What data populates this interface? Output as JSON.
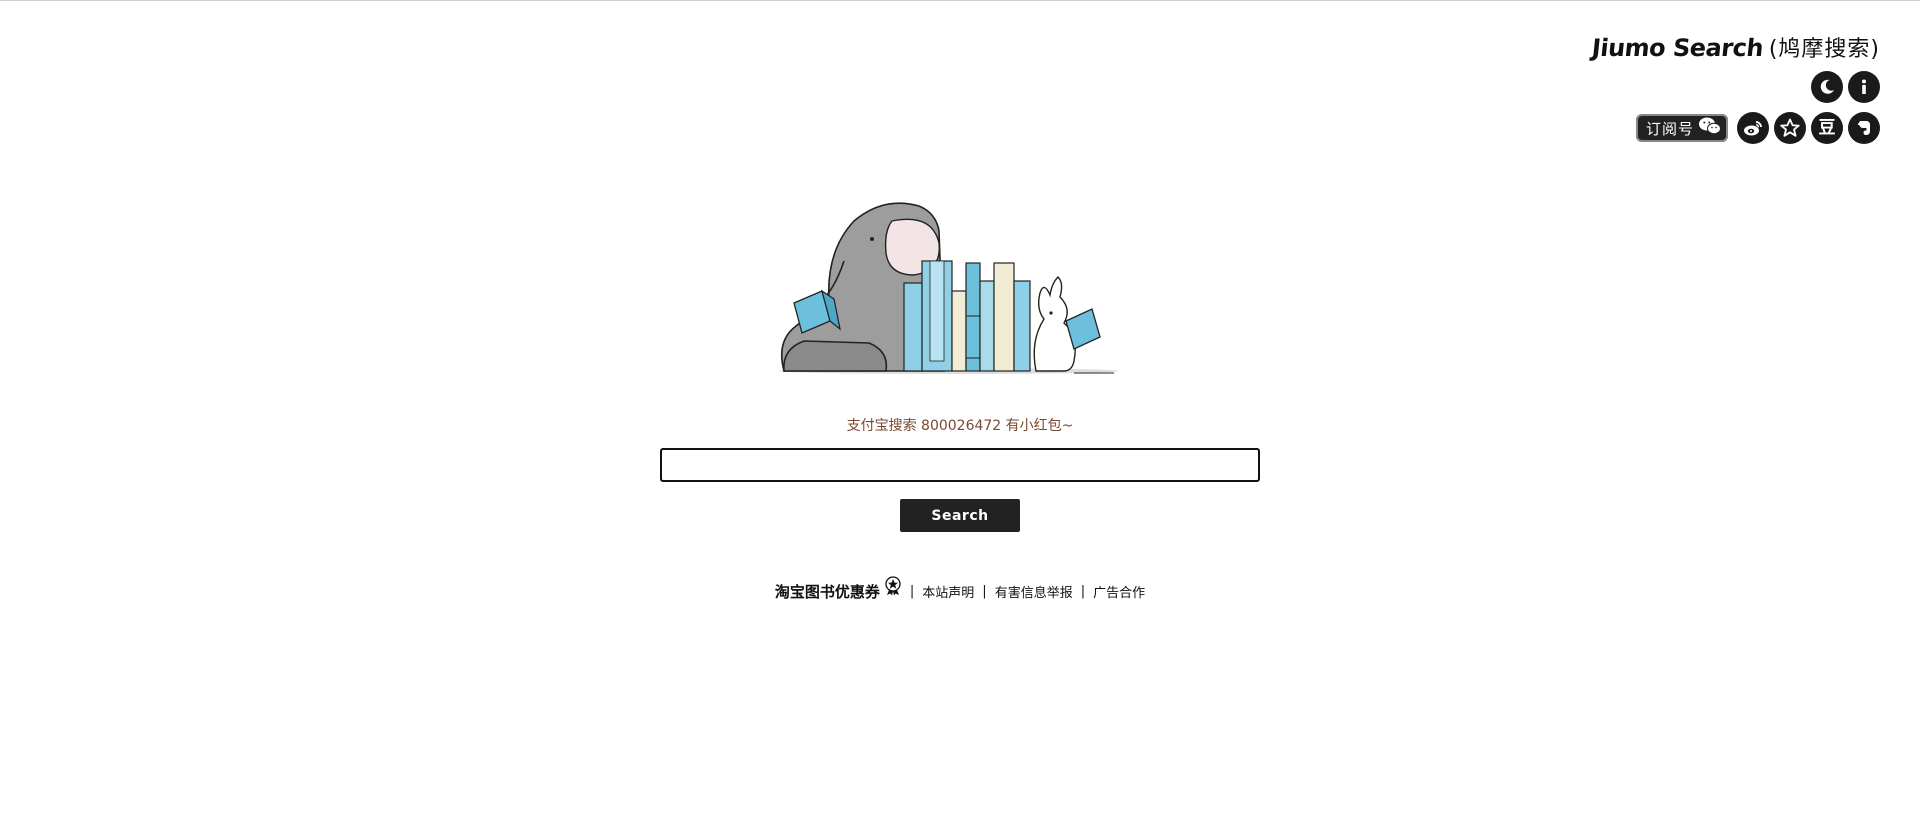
{
  "brand": {
    "title": "Jiumo Search",
    "subtitle": "(鸠摩搜索)"
  },
  "toolbar": {
    "row1": [
      {
        "icon": "moon-icon"
      },
      {
        "icon": "info-icon"
      }
    ],
    "subscribe_label": "订阅号",
    "subscribe_icon": "wechat-icon",
    "row2": [
      {
        "icon": "weibo-icon"
      },
      {
        "icon": "star-icon"
      },
      {
        "icon": "douban-icon",
        "glyph": "豆"
      },
      {
        "icon": "evernote-icon"
      }
    ]
  },
  "illustration": {
    "icon": "elephant-rabbit-books-illustration"
  },
  "promo": {
    "text": "支付宝搜索 800026472 有小红包~"
  },
  "search": {
    "value": "",
    "placeholder": "",
    "button_label": "Search"
  },
  "footer": {
    "coupon_label": "淘宝图书优惠券",
    "separator": "|",
    "links": [
      "本站声明",
      "有害信息举报",
      "广告合作"
    ]
  },
  "colors": {
    "promo_text": "#7a4a30",
    "dark": "#222222",
    "book_blue": "#8fd0e6",
    "book_cream": "#f3ecd4"
  }
}
